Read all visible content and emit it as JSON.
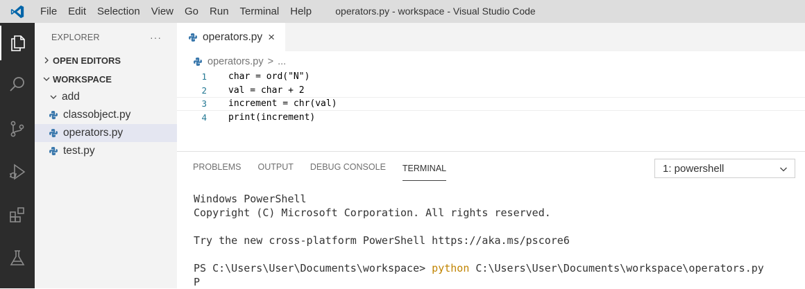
{
  "window": {
    "title": "operators.py - workspace - Visual Studio Code"
  },
  "menu": [
    "File",
    "Edit",
    "Selection",
    "View",
    "Go",
    "Run",
    "Terminal",
    "Help"
  ],
  "activity_bar": [
    "files-icon",
    "search-icon",
    "source-control-icon",
    "run-debug-icon",
    "extensions-icon",
    "testing-icon"
  ],
  "sidebar": {
    "title": "EXPLORER",
    "more": "···",
    "open_editors": "OPEN EDITORS",
    "workspace": "WORKSPACE",
    "items": [
      {
        "label": "add",
        "type": "folder"
      },
      {
        "label": "classobject.py",
        "type": "python"
      },
      {
        "label": "operators.py",
        "type": "python",
        "selected": true
      },
      {
        "label": "test.py",
        "type": "python"
      }
    ]
  },
  "editor": {
    "tab": {
      "label": "operators.py",
      "close": "×"
    },
    "breadcrumb": {
      "file": "operators.py",
      "sep": ">",
      "rest": "..."
    },
    "lines": [
      {
        "n": "1",
        "code": "char = ord(\"N\")"
      },
      {
        "n": "2",
        "code": "val = char + 2"
      },
      {
        "n": "3",
        "code": "increment = chr(val)"
      },
      {
        "n": "4",
        "code": "print(increment)"
      }
    ]
  },
  "panel": {
    "tabs": [
      "PROBLEMS",
      "OUTPUT",
      "DEBUG CONSOLE",
      "TERMINAL"
    ],
    "active_tab": "TERMINAL",
    "shell_select": "1: powershell",
    "terminal": {
      "line1": "Windows PowerShell",
      "line2": "Copyright (C) Microsoft Corporation. All rights reserved.",
      "line3": "Try the new cross-platform PowerShell https://aka.ms/pscore6",
      "prompt": "PS C:\\Users\\User\\Documents\\workspace> ",
      "command": "python",
      "args": " C:\\Users\\User\\Documents\\workspace\\operators.py",
      "output": "P"
    }
  },
  "colors": {
    "accent": "#0065a9",
    "activity_bar": "#2c2c2c",
    "command": "#c18401",
    "python_icon": "#3776ab"
  }
}
